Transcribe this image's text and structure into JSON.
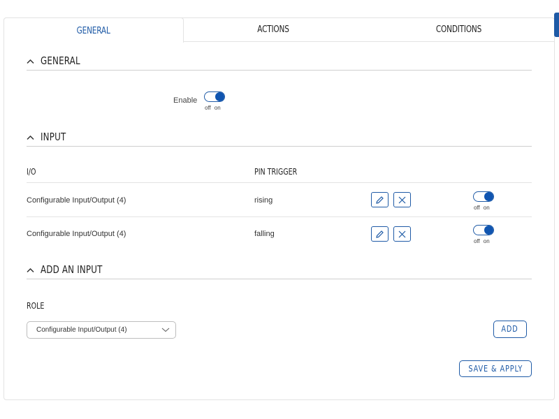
{
  "tabs": [
    {
      "label": "GENERAL",
      "active": true
    },
    {
      "label": "ACTIONS",
      "active": false
    },
    {
      "label": "CONDITIONS",
      "active": false
    }
  ],
  "general_section": {
    "title": "GENERAL",
    "enable_label": "Enable",
    "enable_toggle": {
      "off": "off",
      "on": "on",
      "state": "on"
    }
  },
  "input_section": {
    "title": "INPUT",
    "columns": {
      "io": "I/O",
      "pin_trigger": "PIN TRIGGER"
    },
    "rows": [
      {
        "io": "Configurable Input/Output (4)",
        "trigger": "rising",
        "toggle_off": "off",
        "toggle_on": "on",
        "state": "on"
      },
      {
        "io": "Configurable Input/Output (4)",
        "trigger": "falling",
        "toggle_off": "off",
        "toggle_on": "on",
        "state": "on"
      }
    ]
  },
  "add_section": {
    "title": "ADD AN INPUT",
    "role_label": "ROLE",
    "role_value": "Configurable Input/Output (4)",
    "add_button": "ADD"
  },
  "footer": {
    "save_apply": "SAVE & APPLY"
  },
  "colors": {
    "accent": "#1e5aa6",
    "border": "#e3e3e3"
  },
  "icons": [
    "chevron-up-icon",
    "pencil-icon",
    "close-icon",
    "chevron-down-icon"
  ]
}
